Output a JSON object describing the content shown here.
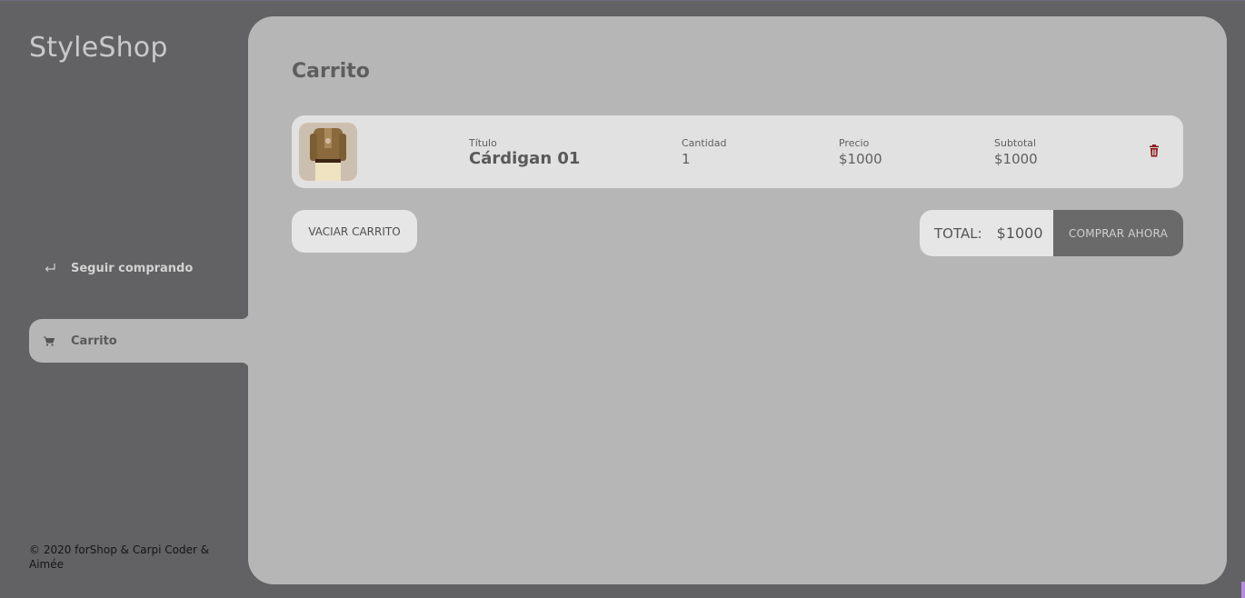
{
  "brand": "StyleShop",
  "sidebar": {
    "items": [
      {
        "label": "Seguir comprando",
        "icon": "return-arrow-icon"
      },
      {
        "label": "Carrito",
        "icon": "cart-icon",
        "active": true
      }
    ]
  },
  "footer": "© 2020 forShop & Carpi Coder & Aimée",
  "main": {
    "title": "Carrito",
    "cart_items": [
      {
        "title_label": "Título",
        "title": "Cárdigan 01",
        "qty_label": "Cantidad",
        "qty": "1",
        "price_label": "Precio",
        "price": "$1000",
        "subtotal_label": "Subtotal",
        "subtotal": "$1000"
      }
    ],
    "empty_button": "VACIAR CARRITO",
    "total_label": "TOTAL:",
    "total_value": "$1000",
    "buy_button": "COMPRAR AHORA"
  },
  "colors": {
    "background": "#626264",
    "panel": "#b6b6b6",
    "row": "#e1e1e1",
    "trash": "#8b1a1a"
  }
}
